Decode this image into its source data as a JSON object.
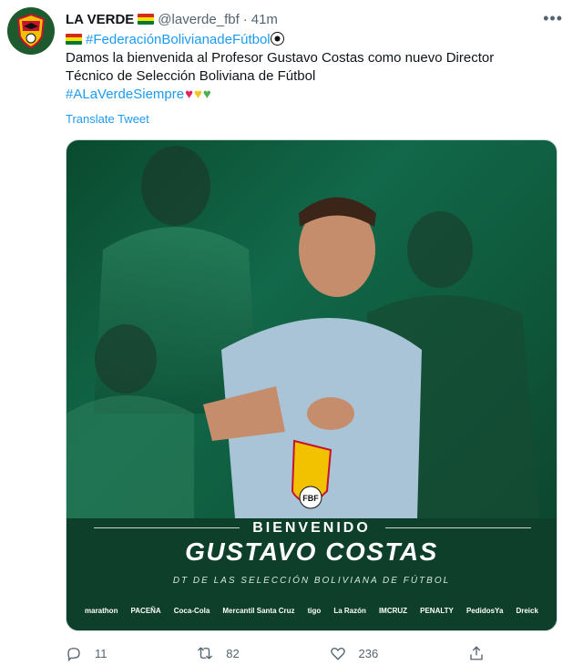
{
  "tweet": {
    "author_name": "LA VERDE",
    "handle": "@laverde_fbf",
    "separator": "·",
    "time": "41m",
    "hashtag1": "#FederaciónBolivianadeFútbol",
    "body_line1": "Damos la bienvenida al Profesor Gustavo Costas como nuevo Director",
    "body_line2": "Técnico de Selección Boliviana de Fútbol",
    "hashtag2": "#ALaVerdeSiempre",
    "translate": "Translate Tweet"
  },
  "media": {
    "line1": "BIENVENIDO",
    "line2": "GUSTAVO COSTAS",
    "line3": "DT DE LAS SELECCIÓN BOLIVIANA DE FÚTBOL",
    "badge_text": "FBF",
    "sponsors": [
      "marathon",
      "PACEÑA",
      "Coca-Cola",
      "Mercantil Santa Cruz",
      "tigo",
      "La Razón",
      "IMCRUZ",
      "PENALTY",
      "PedidosYa",
      "Dreick"
    ]
  },
  "actions": {
    "replies": "11",
    "retweets": "82",
    "likes": "236"
  },
  "colors": {
    "link": "#1d9bf0",
    "muted": "#536471",
    "brand_green": "#0d3f2a"
  }
}
